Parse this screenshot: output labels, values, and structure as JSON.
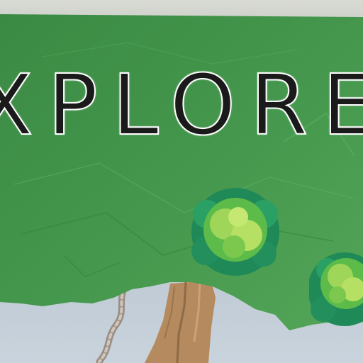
{
  "banner": {
    "title": "XPLORE"
  },
  "decorations": {
    "pom_colors": [
      "#1f8a57",
      "#5dbb4a",
      "#b6e063"
    ],
    "banner_color": "#3f8f48",
    "trunk_color": "#b48a5e"
  }
}
